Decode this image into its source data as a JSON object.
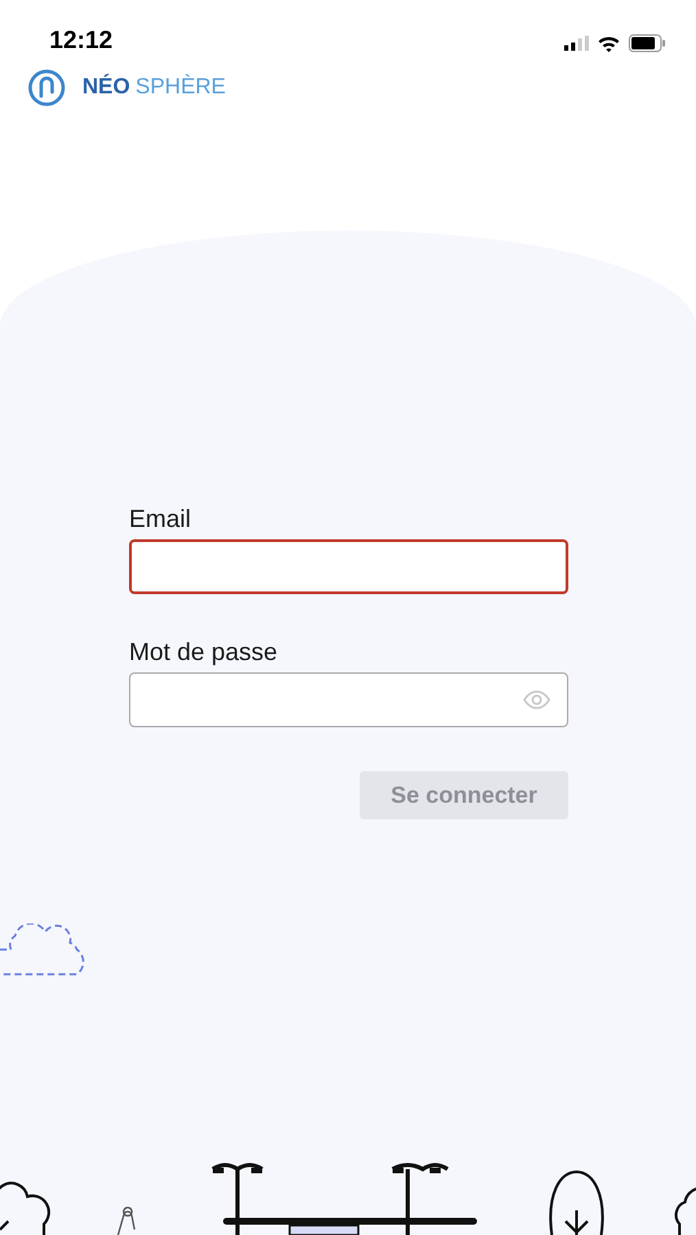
{
  "status_bar": {
    "time": "12:12"
  },
  "logo": {
    "bold": "NÉO",
    "light": "SPHÈRE"
  },
  "form": {
    "fields": [
      {
        "kind": "text",
        "label": "Email",
        "error": true
      },
      {
        "kind": "password",
        "label": "Mot de passe",
        "error": false
      }
    ],
    "submit": {
      "label": "Se connecter",
      "disabled": true
    }
  }
}
